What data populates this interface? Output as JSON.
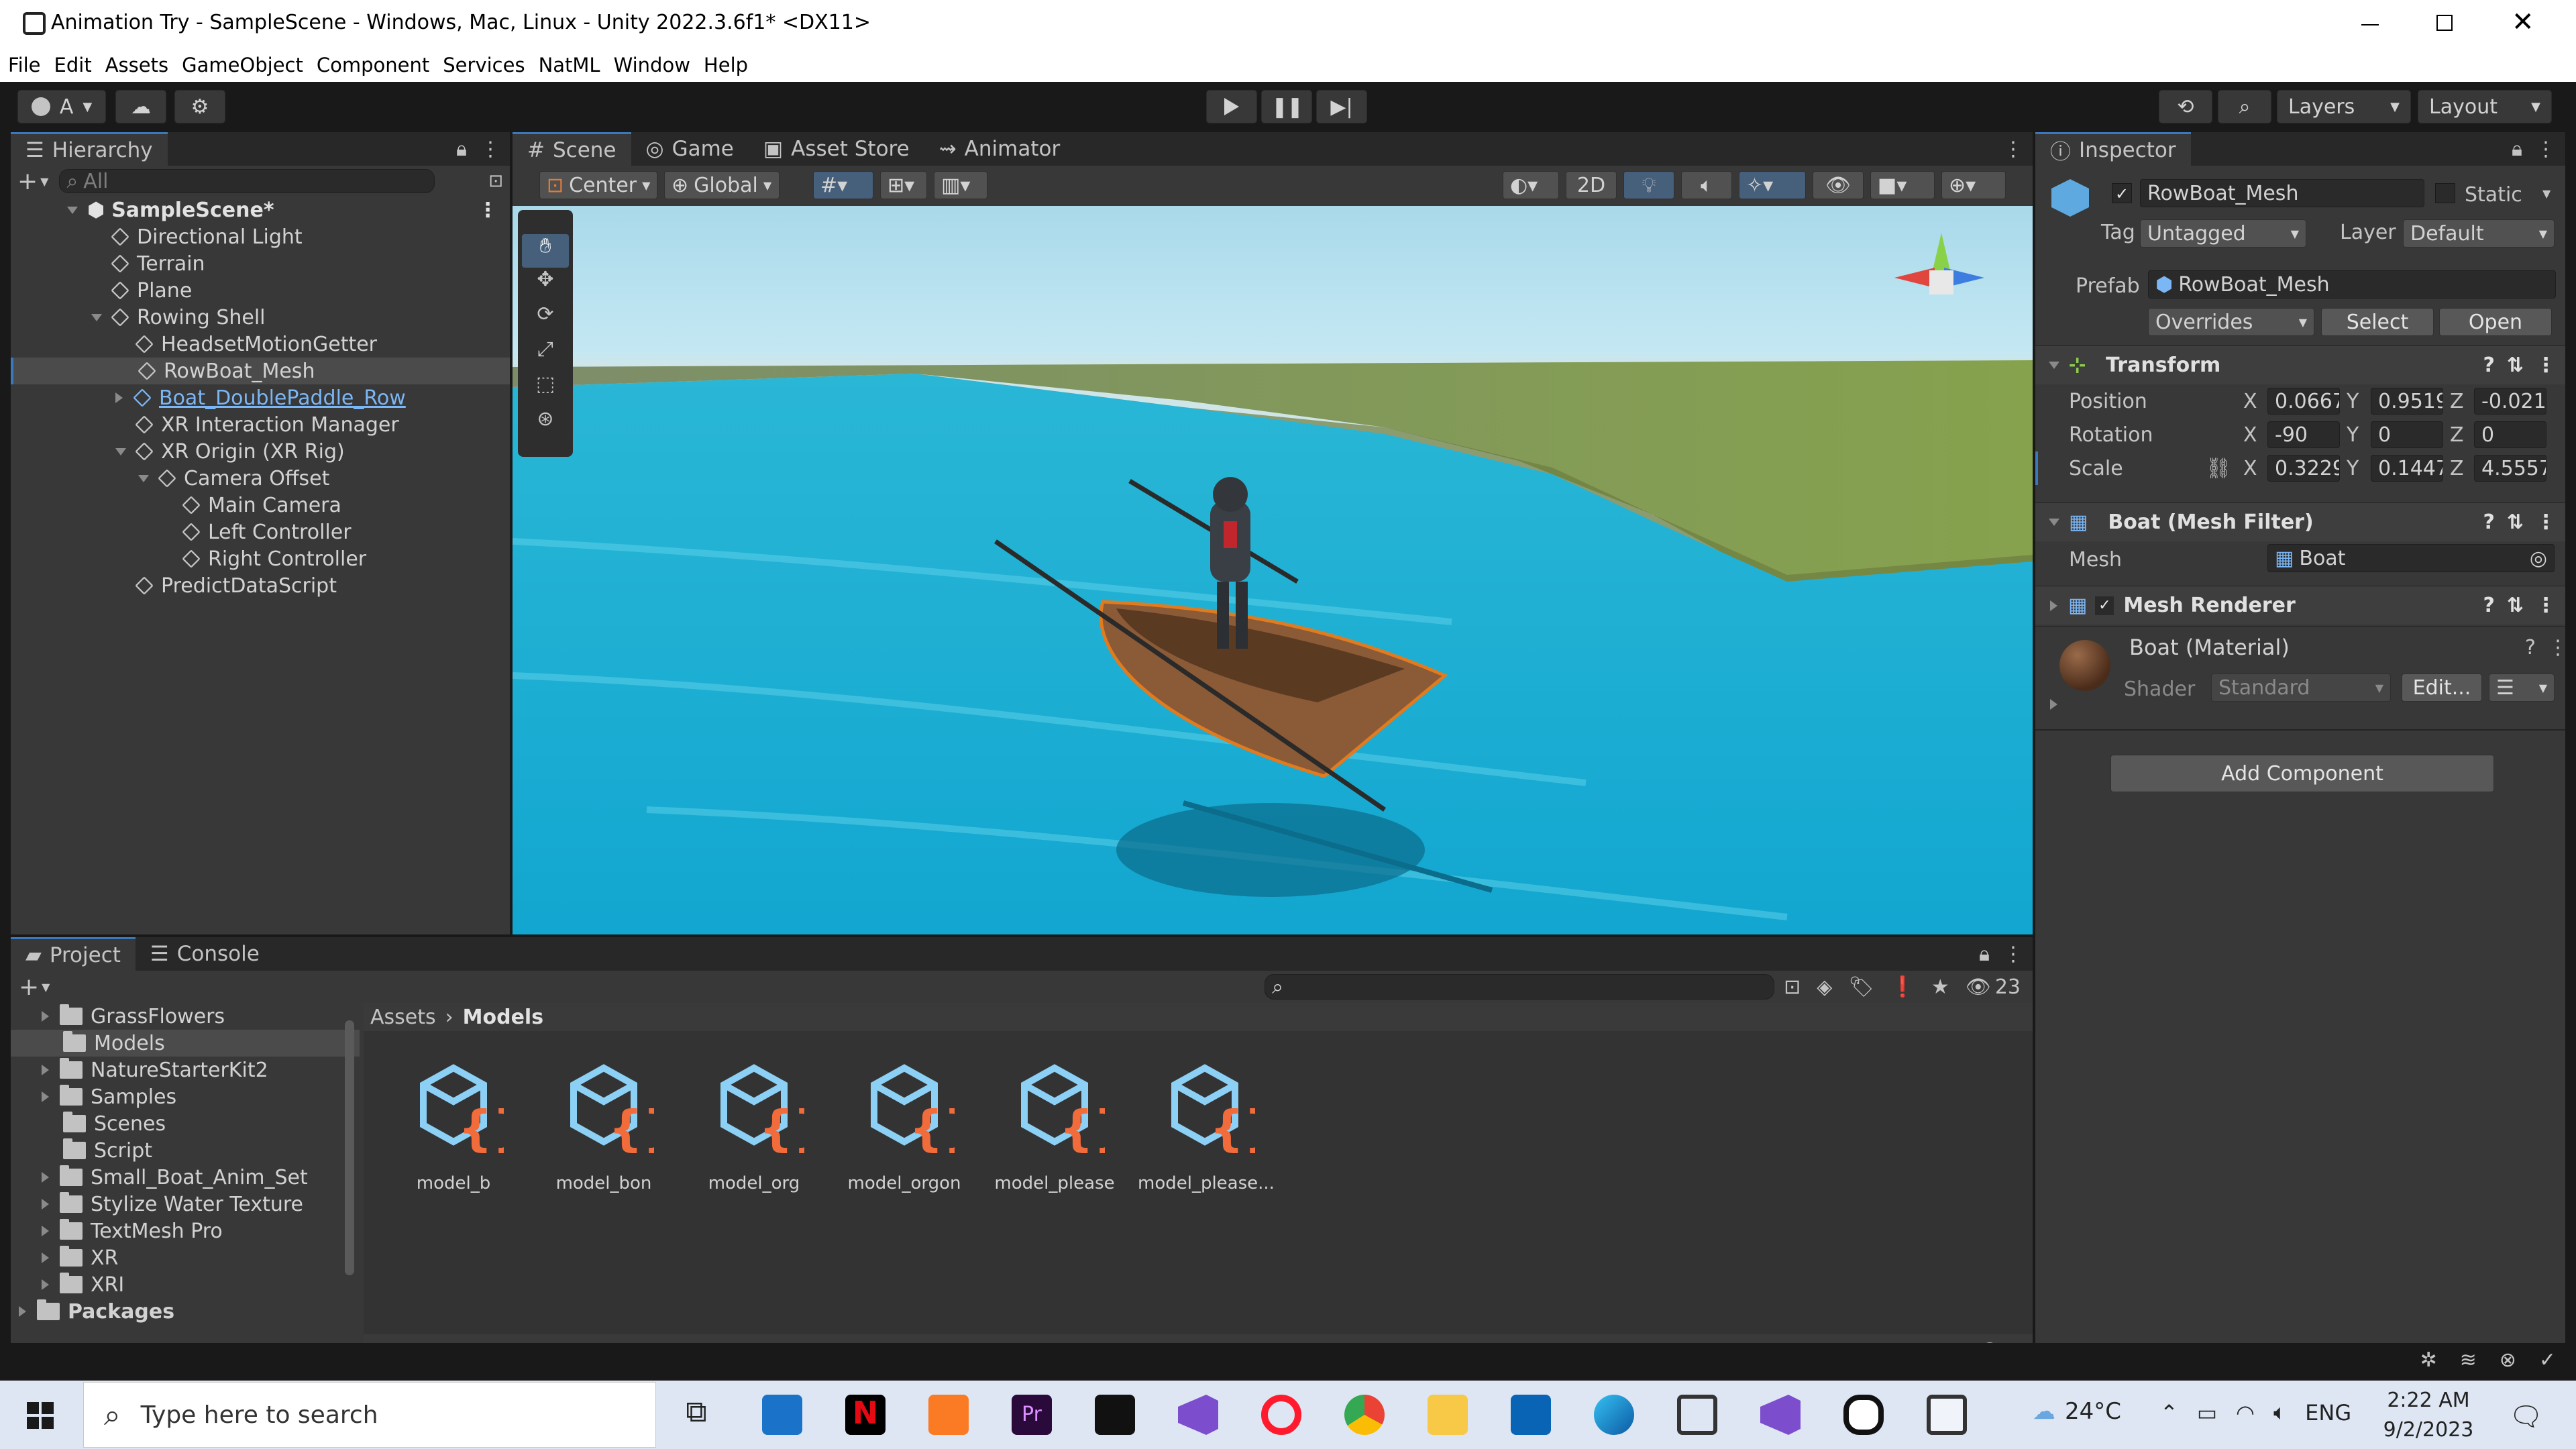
{
  "window": {
    "title": "Animation Try - SampleScene - Windows, Mac, Linux - Unity 2022.3.6f1* <DX11>"
  },
  "menu": [
    "File",
    "Edit",
    "Assets",
    "GameObject",
    "Component",
    "Services",
    "NatML",
    "Window",
    "Help"
  ],
  "toolbar": {
    "account": "A",
    "layers": "Layers",
    "layout": "Layout"
  },
  "hierarchy": {
    "tab": "Hierarchy",
    "search_placeholder": "All",
    "scene": "SampleScene*",
    "items": [
      "Directional Light",
      "Terrain",
      "Plane",
      "Rowing Shell",
      "HeadsetMotionGetter",
      "RowBoat_Mesh",
      "Boat_DoublePaddle_Row",
      "XR Interaction Manager",
      "XR Origin (XR Rig)",
      "Camera Offset",
      "Main Camera",
      "Left Controller",
      "Right Controller",
      "PredictDataScript"
    ]
  },
  "scene_view": {
    "tabs": [
      "Scene",
      "Game",
      "Asset Store",
      "Animator"
    ],
    "pivot": "Center",
    "space": "Global",
    "mode2d": "2D"
  },
  "inspector": {
    "tab": "Inspector",
    "name": "RowBoat_Mesh",
    "static": "Static",
    "tag_label": "Tag",
    "tag": "Untagged",
    "layer_label": "Layer",
    "layer": "Default",
    "prefab_label": "Prefab",
    "prefab": "RowBoat_Mesh",
    "overrides": "Overrides",
    "select": "Select",
    "open": "Open",
    "transform": {
      "title": "Transform",
      "position": {
        "label": "Position",
        "x": "0.0667",
        "y": "0.9519",
        "z": "-0.021"
      },
      "rotation": {
        "label": "Rotation",
        "x": "-90",
        "y": "0",
        "z": "0"
      },
      "scale": {
        "label": "Scale",
        "x": "0.3229",
        "y": "0.1447",
        "z": "4.5557"
      }
    },
    "mesh_filter": {
      "title": "Boat (Mesh Filter)",
      "mesh_label": "Mesh",
      "mesh": "Boat"
    },
    "mesh_renderer": {
      "title": "Mesh Renderer"
    },
    "material": {
      "name": "Boat (Material)",
      "shader_label": "Shader",
      "shader": "Standard",
      "edit": "Edit..."
    },
    "add_component": "Add Component"
  },
  "project": {
    "tabs": [
      "Project",
      "Console"
    ],
    "hidden_count": "23",
    "folders": [
      "GrassFlowers",
      "Models",
      "NatureStarterKit2",
      "Samples",
      "Scenes",
      "Script",
      "Small_Boat_Anim_Set",
      "Stylize Water Texture",
      "TextMesh Pro",
      "XR",
      "XRI",
      "Packages"
    ],
    "breadcrumb": [
      "Assets",
      "Models"
    ],
    "assets": [
      "model_b",
      "model_bon",
      "model_org",
      "model_orgon",
      "model_please",
      "model_please..."
    ]
  },
  "taskbar": {
    "search": "Type here to search",
    "weather": "24°C",
    "lang": "ENG",
    "time": "2:22 AM",
    "date": "9/2/2023"
  }
}
